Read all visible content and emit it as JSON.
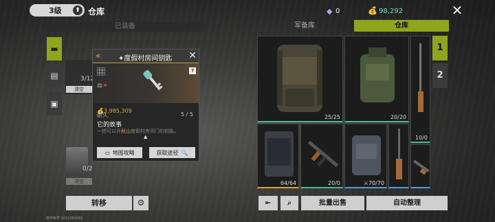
{
  "header": {
    "level": "3级",
    "title": "仓库",
    "gems": "0",
    "money": "98,292"
  },
  "left": {
    "equipped_header": "已装备",
    "slot1_count": "3/12",
    "slot1_empty": "清空",
    "slot2_count": "0/2",
    "slot2_empty": "清空",
    "transfer": "转移",
    "uid": "数字账号 1011362091"
  },
  "popup": {
    "title": "✦度假村房间钥匙",
    "value": "3,985,309",
    "durability_label": "耐久",
    "durability_value": "5 / 5",
    "story_title": "它的故事",
    "story_text_pre": "一把可以开",
    "story_text_hl": "秋山",
    "story_text_post": "度假村房间门的钥匙。",
    "map_guide": "地图攻略",
    "get_path": "获取途径"
  },
  "tabs": {
    "arsenal": "军备库",
    "warehouse": "仓库"
  },
  "grid": [
    {
      "name": "backpack-item",
      "count": "25/25",
      "color": "green"
    },
    {
      "name": "vest-item",
      "count": "20/20",
      "color": "green"
    },
    {
      "name": "rifle-item-1",
      "count": "10/0",
      "color": "green"
    },
    {
      "name": "case-item",
      "count": "64/64",
      "color": "orange"
    },
    {
      "name": "ak-item",
      "count": "20/0",
      "color": "green"
    },
    {
      "name": "armor-item",
      "count": "⚔70/70",
      "color": "blue"
    },
    {
      "name": "rifle-item-2",
      "count": "",
      "color": "blue"
    },
    {
      "name": "rifle-item-3",
      "count": "",
      "color": "blue"
    }
  ],
  "pages": [
    "1",
    "2"
  ],
  "bottom": {
    "bulk_sell": "批量出售",
    "auto_sort": "自动整理"
  }
}
